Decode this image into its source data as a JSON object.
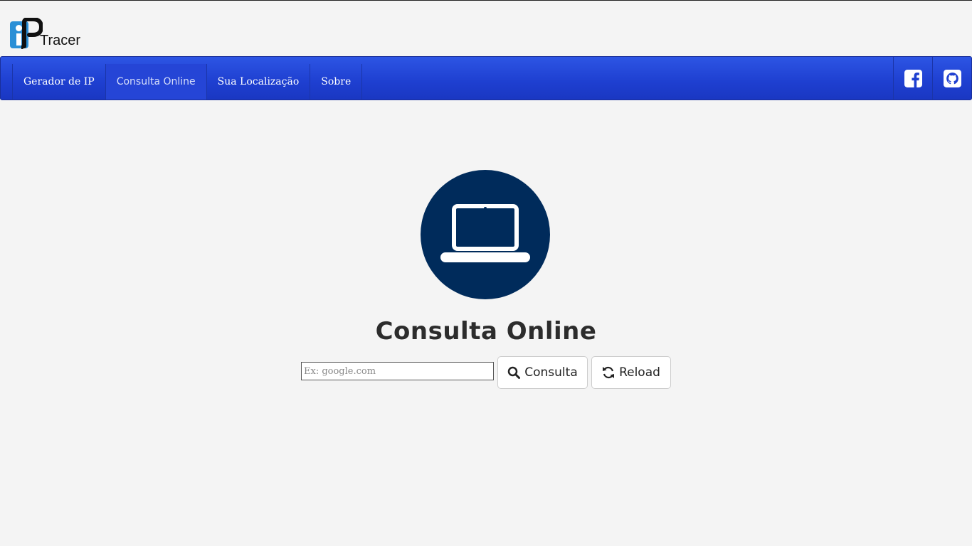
{
  "brand": {
    "logo_text": "Tracer"
  },
  "nav": {
    "items": [
      {
        "label": "Gerador de IP",
        "active": false
      },
      {
        "label": "Consulta Online",
        "active": true
      },
      {
        "label": "Sua Localização",
        "active": false
      },
      {
        "label": "Sobre",
        "active": false
      }
    ],
    "social_icons": [
      "facebook-icon",
      "github-icon"
    ]
  },
  "main": {
    "hero_icon": "laptop-icon",
    "title": "Consulta Online",
    "search": {
      "placeholder": "Ex: google.com",
      "value": ""
    },
    "buttons": {
      "consulta_label": "Consulta",
      "reload_label": "Reload"
    }
  },
  "colors": {
    "navbar": "#1e3fd0",
    "hero_circle": "#002b5b",
    "logo_blue": "#2a8fd6",
    "background": "#f4f4f4"
  }
}
